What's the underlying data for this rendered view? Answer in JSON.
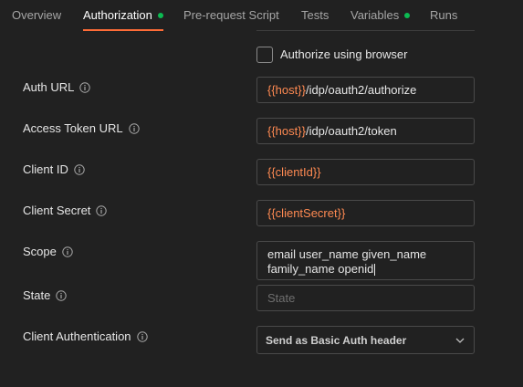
{
  "tabs": [
    {
      "label": "Overview",
      "active": false,
      "dot": false
    },
    {
      "label": "Authorization",
      "active": true,
      "dot": true
    },
    {
      "label": "Pre-request Script",
      "active": false,
      "dot": false
    },
    {
      "label": "Tests",
      "active": false,
      "dot": false
    },
    {
      "label": "Variables",
      "active": false,
      "dot": true
    },
    {
      "label": "Runs",
      "active": false,
      "dot": false
    }
  ],
  "authorize_browser": {
    "label": "Authorize using browser",
    "checked": false
  },
  "fields": {
    "auth_url": {
      "label": "Auth URL",
      "var": "{{host}}",
      "rest": "/idp/oauth2/authorize"
    },
    "access_token_url": {
      "label": "Access Token URL",
      "var": "{{host}}",
      "rest": "/idp/oauth2/token"
    },
    "client_id": {
      "label": "Client ID",
      "var": "{{clientId}}"
    },
    "client_secret": {
      "label": "Client Secret",
      "var": "{{clientSecret}}"
    },
    "scope": {
      "label": "Scope",
      "line1": "email user_name given_name",
      "line2": "family_name openid"
    },
    "state": {
      "label": "State",
      "placeholder": "State"
    },
    "client_auth": {
      "label": "Client Authentication",
      "value": "Send as Basic Auth header"
    }
  },
  "colors": {
    "accent": "#ff6c37",
    "dot": "#0cbb52",
    "variable": "#ff8a52",
    "background": "#212121"
  },
  "icons": {
    "info": "info-icon",
    "dropdown": "chevron-down-icon"
  }
}
